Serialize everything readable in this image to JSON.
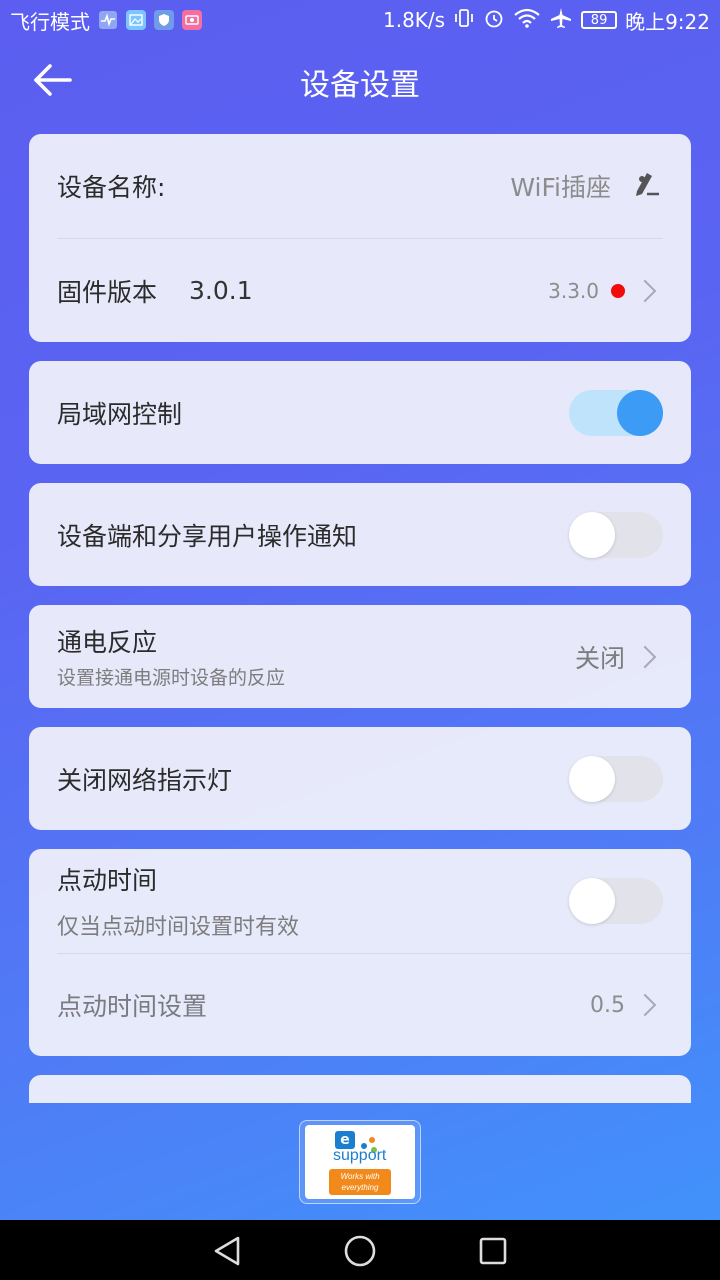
{
  "status_bar": {
    "mode": "飞行模式",
    "speed": "1.8K/s",
    "battery": "89",
    "time": "晚上9:22"
  },
  "header": {
    "title": "设备设置"
  },
  "device_name": {
    "label": "设备名称:",
    "value": "WiFi插座"
  },
  "firmware": {
    "label": "固件版本",
    "current": "3.0.1",
    "latest": "3.3.0"
  },
  "lan_control": {
    "label": "局域网控制",
    "enabled": true
  },
  "share_notify": {
    "label": "设备端和分享用户操作通知",
    "enabled": false
  },
  "power_on": {
    "label": "通电反应",
    "sub_label": "设置接通电源时设备的反应",
    "value": "关闭"
  },
  "network_light": {
    "label": "关闭网络指示灯",
    "enabled": false
  },
  "inching": {
    "label": "点动时间",
    "sub_label": "仅当点动时间设置时有效",
    "enabled": false,
    "setting_label": "点动时间设置",
    "setting_value": "0.5"
  },
  "logo": {
    "letter": "e",
    "name": "support",
    "tagline_1": "Works with",
    "tagline_2": "everything",
    "colors": {
      "blue": "#1b7fd0",
      "orange": "#f28a1b"
    }
  },
  "colors": {
    "toggle_on_knob": "#3b9bf5",
    "toggle_on_track": "#bfe3fb",
    "update_dot": "#f20b0b"
  }
}
